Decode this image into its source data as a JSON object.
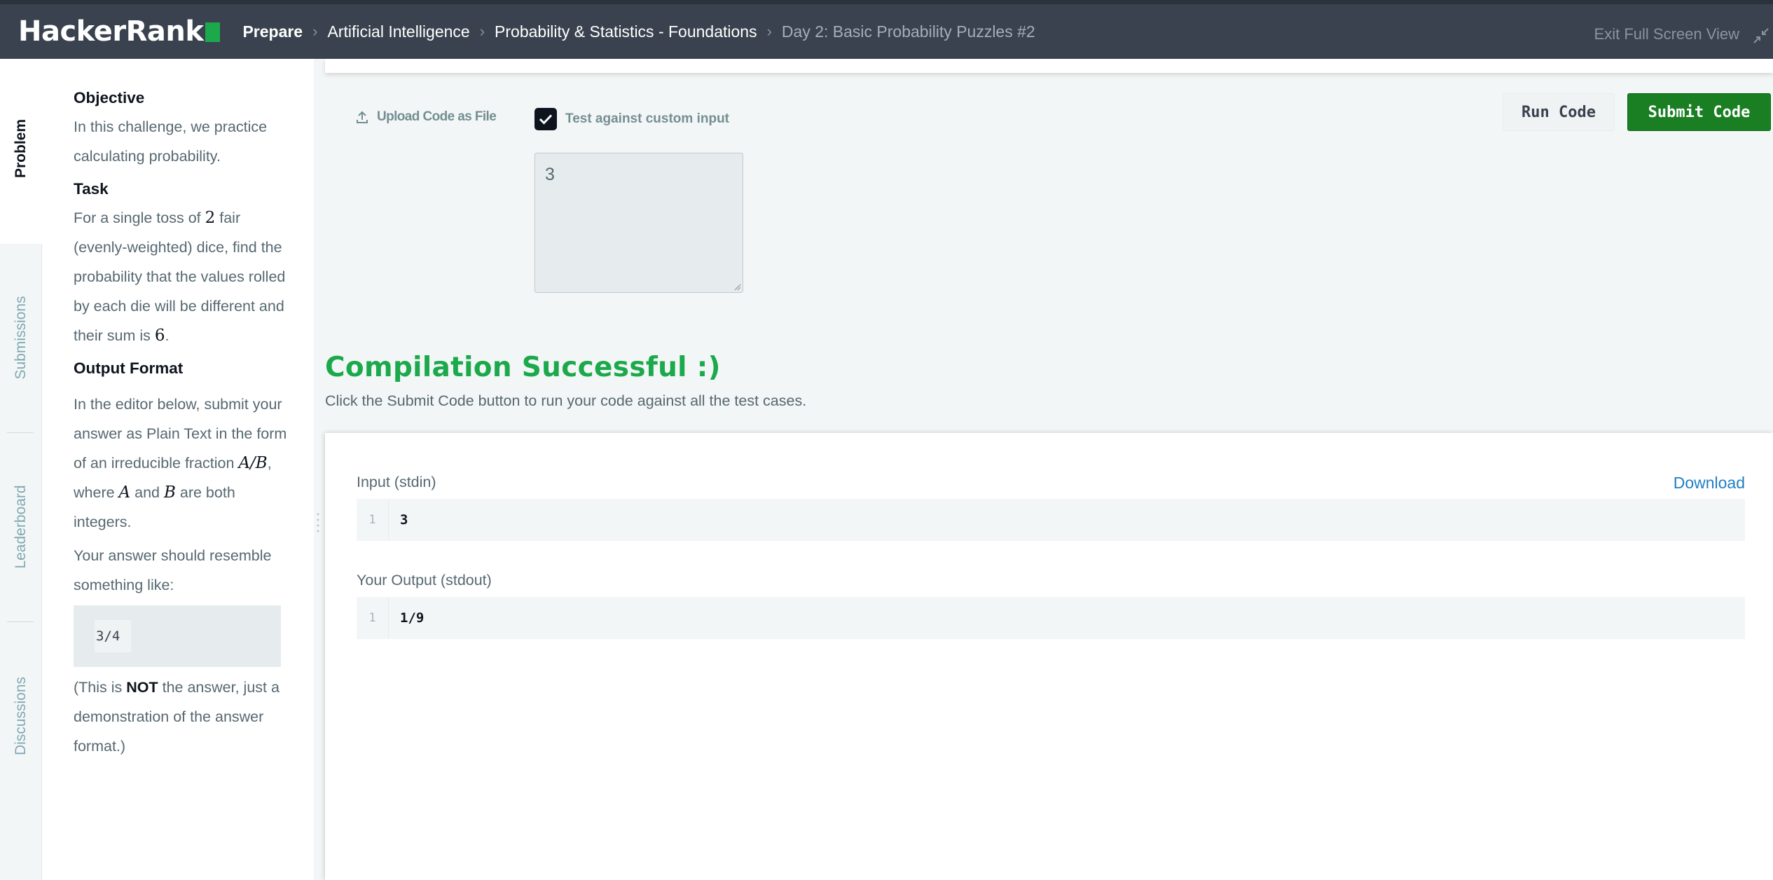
{
  "header": {
    "logo_text": "HackerRank",
    "breadcrumbs": [
      "Prepare",
      "Artificial Intelligence",
      "Probability & Statistics - Foundations",
      "Day 2: Basic Probability Puzzles #2"
    ],
    "exit_fullscreen": "Exit Full Screen View"
  },
  "sidebar": {
    "tabs": [
      "Problem",
      "Submissions",
      "Leaderboard",
      "Discussions"
    ]
  },
  "problem": {
    "objective_heading": "Objective",
    "objective_text": "In this challenge, we practice calculating probability.",
    "task_heading": "Task",
    "task_pre": "For a single toss of ",
    "task_num_dice": "2",
    "task_mid": " fair (evenly-weighted) dice, find the probability that the values rolled by each die will be different and their sum is ",
    "task_sum": "6",
    "task_end": ".",
    "output_heading": "Output Format",
    "output_pre": "In the editor below, submit your answer as Plain Text in the form of an irreducible fraction ",
    "output_fraction": "A/B",
    "output_mid": ", where ",
    "output_a": "A",
    "output_and": " and ",
    "output_b": "B",
    "output_end": " are both integers.",
    "resemble_text": "Your answer should resemble something like:",
    "example": "3/4",
    "note_pre": "(This is ",
    "note_strong": "NOT",
    "note_post": " the answer, just a demonstration of the answer format.)"
  },
  "toolbar": {
    "upload_label": "Upload Code as File",
    "custom_input_label": "Test against custom input",
    "custom_input_checked": true,
    "custom_input_value": "3",
    "run_label": "Run Code",
    "submit_label": "Submit Code"
  },
  "result": {
    "title": "Compilation Successful :)",
    "subtitle": "Click the Submit Code button to run your code against all the test cases.",
    "input_label": "Input (stdin)",
    "download_label": "Download",
    "input_line_no": "1",
    "input_value": "3",
    "output_label": "Your Output (stdout)",
    "output_line_no": "1",
    "output_value": "1/9"
  },
  "colors": {
    "header_bg": "#39424e",
    "brand_green": "#1ba94c",
    "submit_green": "#1a7e23",
    "link_blue": "#1f7ec4"
  },
  "icons": [
    "upload-icon",
    "checkmark-icon",
    "exit-fullscreen-icon",
    "chevron-right-icon"
  ]
}
